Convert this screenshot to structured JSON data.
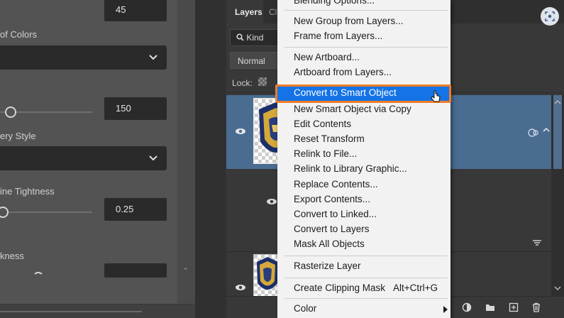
{
  "left_panel": {
    "top_value": "45",
    "colors_label": "of Colors",
    "value_150": "150",
    "fiery_style_label": "ery Style",
    "line_tightness_label": "ine Tightness",
    "tightness_value": "0.25",
    "thickness_label": "kness"
  },
  "layers_panel": {
    "tab_layers": "Layers",
    "tab_channels_partial": "Cl",
    "kind_filter": "Kind",
    "blend_mode": "Normal",
    "lock_label": "Lock:"
  },
  "context_menu": {
    "items": [
      {
        "label": "Blending Options..."
      },
      {
        "label": "New Group from Layers..."
      },
      {
        "label": "Frame from Layers..."
      },
      {
        "label": "New Artboard..."
      },
      {
        "label": "Artboard from Layers..."
      },
      {
        "label": "Convert to Smart Object"
      },
      {
        "label": "New Smart Object via Copy"
      },
      {
        "label": "Edit Contents"
      },
      {
        "label": "Reset Transform"
      },
      {
        "label": "Relink to File..."
      },
      {
        "label": "Relink to Library Graphic..."
      },
      {
        "label": "Replace Contents..."
      },
      {
        "label": "Export Contents..."
      },
      {
        "label": "Convert to Linked..."
      },
      {
        "label": "Convert to Layers"
      },
      {
        "label": "Mask All Objects"
      },
      {
        "label": "Rasterize Layer"
      },
      {
        "label": "Create Clipping Mask",
        "shortcut": "Alt+Ctrl+G"
      },
      {
        "label": "Color"
      }
    ]
  },
  "colors": {
    "menu_highlight": "#1473e6",
    "highlight_outline": "#f07d28",
    "selected_layer": "#4a6c91"
  },
  "icons": [
    "search-icon",
    "eye-icon",
    "checker-lock-icon",
    "smart-object-badge-icon",
    "capture-icon",
    "trash-icon",
    "new-layer-icon",
    "folder-icon",
    "adjustment-icon",
    "mask-icon",
    "cursor-icon"
  ]
}
